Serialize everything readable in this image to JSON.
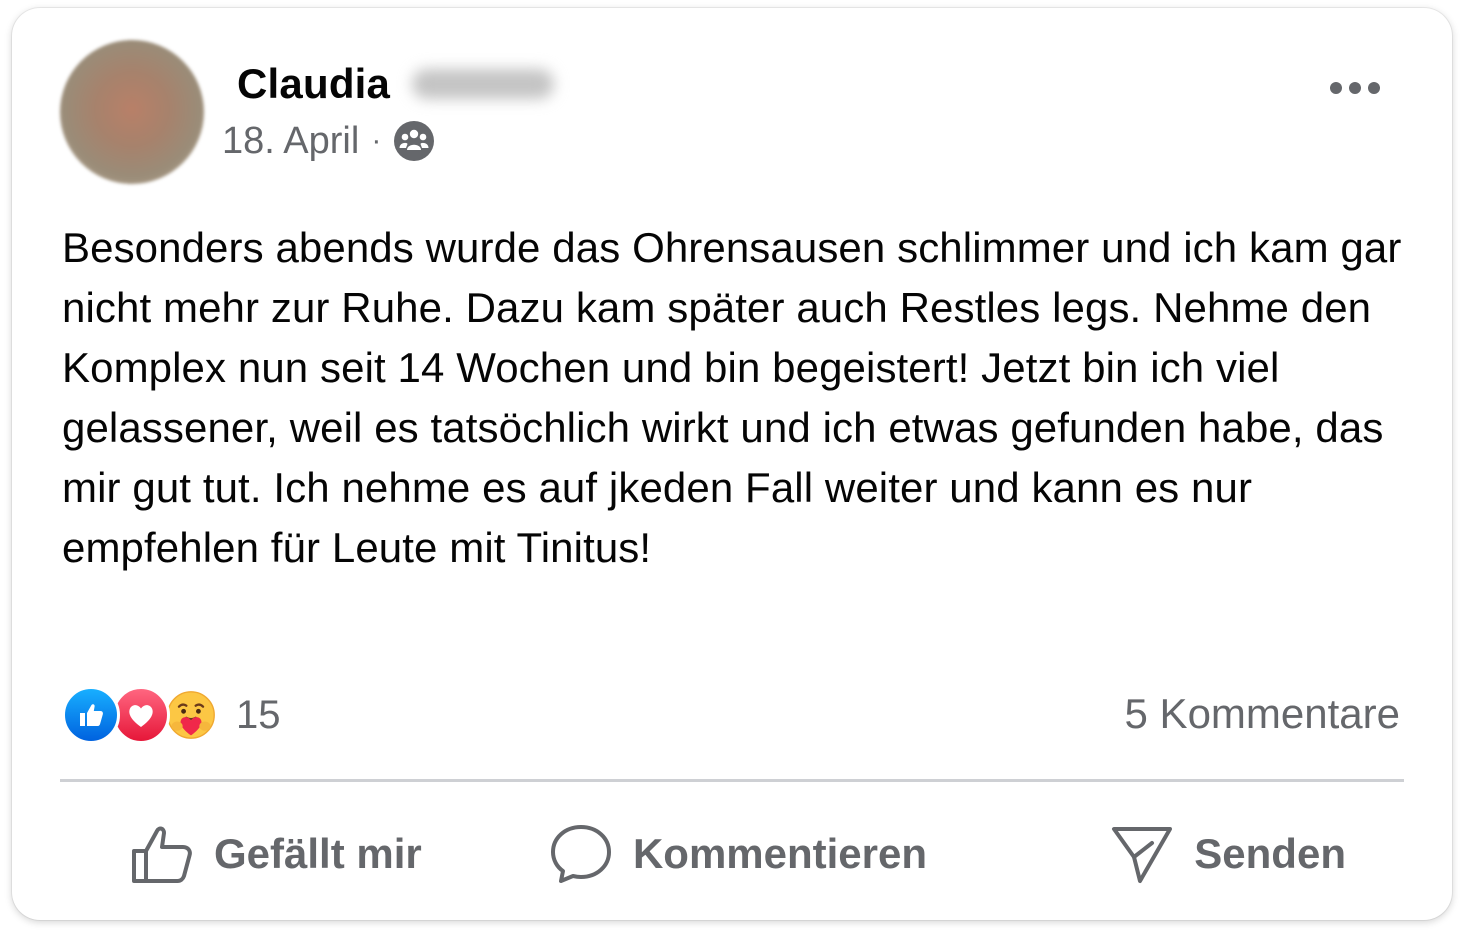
{
  "post": {
    "author": {
      "first_name": "Claudia",
      "last_name_blurred": true
    },
    "date": "18. April",
    "separator": "·",
    "audience_icon": "group-audience-icon",
    "body": "Besonders abends wurde das Ohrensausen schlimmer und ich kam gar nicht mehr zur Ruhe. Dazu kam später auch Restles legs. Nehme den Komplex nun seit 14 Wochen und bin begeistert! Jetzt bin ich viel gelassener, weil es tatsöchlich wirkt und ich etwas gefunden habe, das mir gut tut. Ich nehme es auf jkeden Fall weiter und kann es nur empfehlen für Leute mit Tinitus!",
    "reactions": {
      "types": [
        "like",
        "love",
        "care"
      ],
      "count": "15"
    },
    "comments_label": "5 Kommentare"
  },
  "actions": {
    "like_label": "Gefällt mir",
    "comment_label": "Kommentieren",
    "send_label": "Senden"
  },
  "colors": {
    "text_primary": "#050505",
    "text_secondary": "#65676b",
    "like_blue": "#0866ff",
    "love_red": "#f33e58",
    "divider": "#ced0d4"
  }
}
